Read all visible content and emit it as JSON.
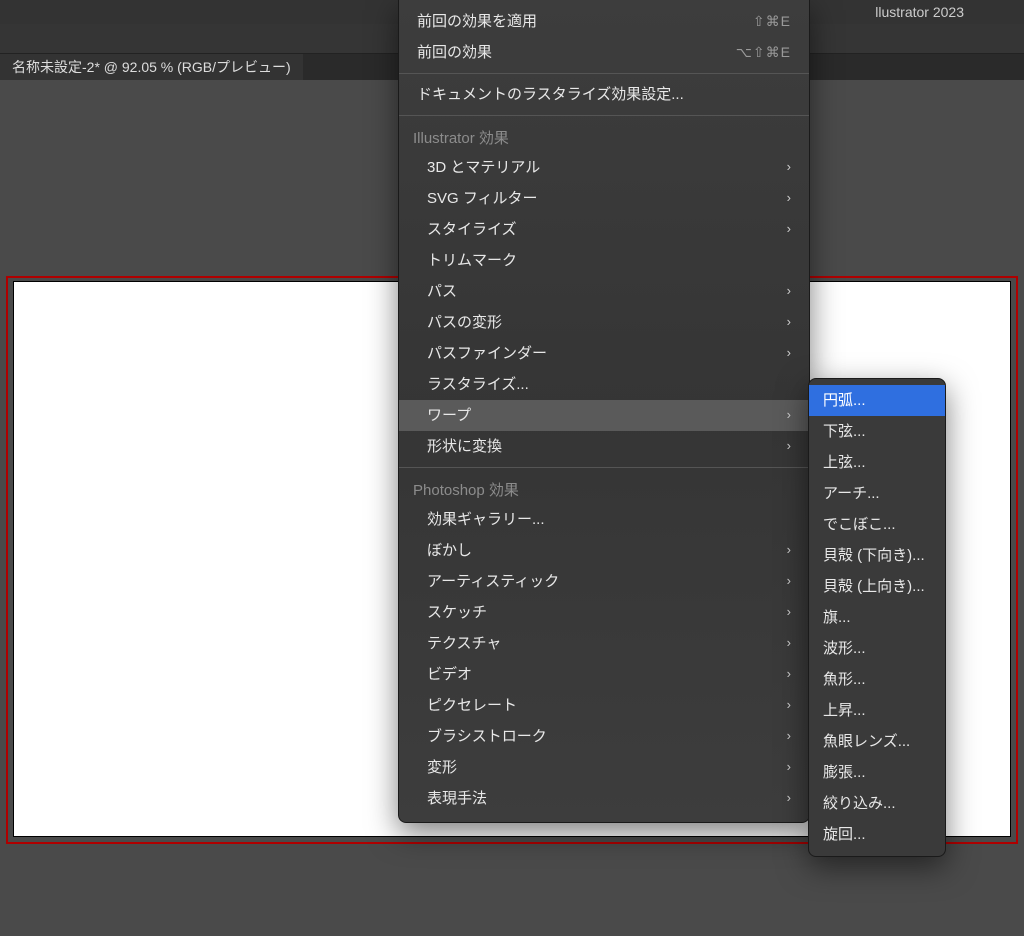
{
  "app_title_fragment": "llustrator 2023",
  "document_tab": "名称未設定-2* @ 92.05 % (RGB/プレビュー)",
  "menu": {
    "apply_last": {
      "label": "前回の効果を適用",
      "shortcut": "⇧⌘E"
    },
    "last_effect": {
      "label": "前回の効果",
      "shortcut": "⌥⇧⌘E"
    },
    "raster_settings": "ドキュメントのラスタライズ効果設定...",
    "illustrator_header": "Illustrator 効果",
    "illustrator_items": [
      {
        "label": "3D とマテリアル",
        "arrow": true
      },
      {
        "label": "SVG フィルター",
        "arrow": true
      },
      {
        "label": "スタイライズ",
        "arrow": true
      },
      {
        "label": "トリムマーク",
        "arrow": false
      },
      {
        "label": "パス",
        "arrow": true
      },
      {
        "label": "パスの変形",
        "arrow": true
      },
      {
        "label": "パスファインダー",
        "arrow": true
      },
      {
        "label": "ラスタライズ...",
        "arrow": false
      },
      {
        "label": "ワープ",
        "arrow": true,
        "highlight": true
      },
      {
        "label": "形状に変換",
        "arrow": true
      }
    ],
    "photoshop_header": "Photoshop 効果",
    "photoshop_items": [
      {
        "label": "効果ギャラリー...",
        "arrow": false
      },
      {
        "label": "ぼかし",
        "arrow": true
      },
      {
        "label": "アーティスティック",
        "arrow": true
      },
      {
        "label": "スケッチ",
        "arrow": true
      },
      {
        "label": "テクスチャ",
        "arrow": true
      },
      {
        "label": "ビデオ",
        "arrow": true
      },
      {
        "label": "ピクセレート",
        "arrow": true
      },
      {
        "label": "ブラシストローク",
        "arrow": true
      },
      {
        "label": "変形",
        "arrow": true
      },
      {
        "label": "表現手法",
        "arrow": true
      }
    ]
  },
  "submenu": {
    "items": [
      "円弧...",
      "下弦...",
      "上弦...",
      "アーチ...",
      "でこぼこ...",
      "貝殻 (下向き)...",
      "貝殻 (上向き)...",
      "旗...",
      "波形...",
      "魚形...",
      "上昇...",
      "魚眼レンズ...",
      "膨張...",
      "絞り込み...",
      "旋回..."
    ],
    "selected_index": 0
  }
}
